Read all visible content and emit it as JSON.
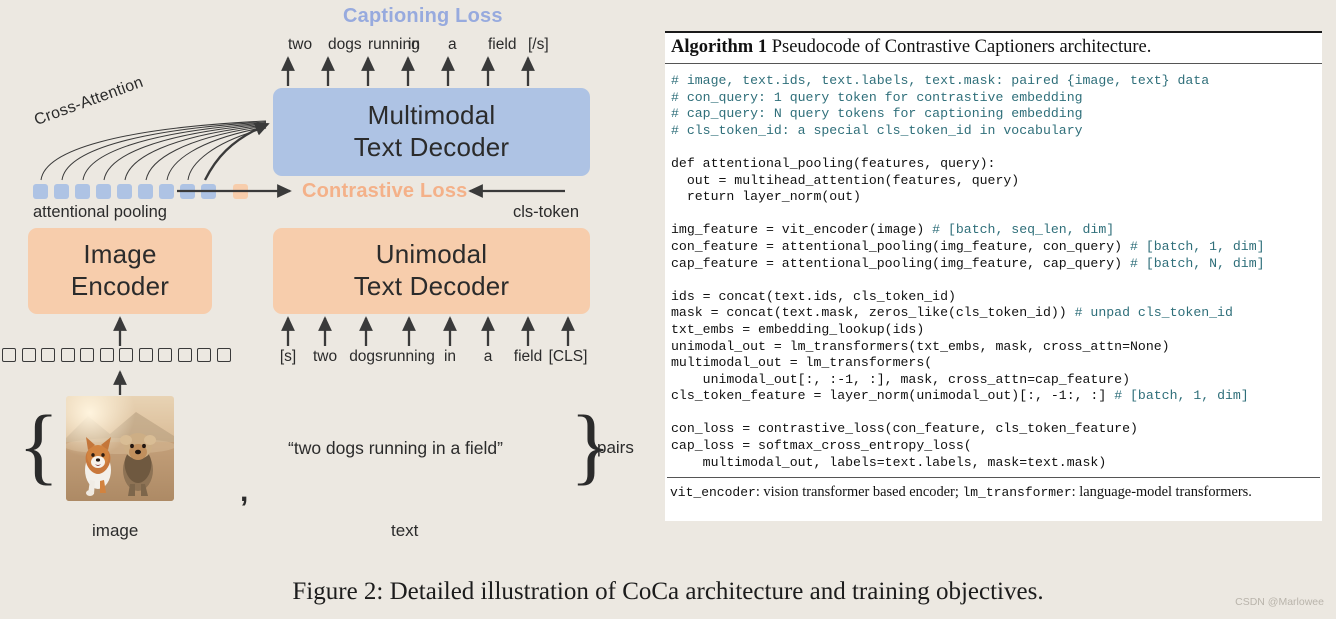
{
  "background_color": "#ece8e1",
  "colors": {
    "box_blue": "#aec3e4",
    "box_orange": "#f7cdac",
    "captioning_loss_text": "#97aade",
    "contrastive_loss_text": "#f4b189",
    "code_comment": "#2f6f7a",
    "arrow": "#3a3a3a"
  },
  "diagram": {
    "captioning_loss_label": "Captioning Loss",
    "contrastive_loss_label": "Contrastive Loss",
    "cross_attention_label": "Cross-Attention",
    "attentional_pooling_label": "attentional pooling",
    "cls_token_label": "cls-token",
    "output_words": [
      "two",
      "dogs",
      "running",
      "in",
      "a",
      "field",
      "[/s]"
    ],
    "input_words": [
      "[s]",
      "two",
      "dogs",
      "running",
      "in",
      "a",
      "field",
      "[CLS]"
    ],
    "boxes": {
      "multimodal_text_decoder": {
        "line1": "Multimodal",
        "line2": "Text Decoder"
      },
      "image_encoder": {
        "line1": "Image",
        "line2": "Encoder"
      },
      "unimodal_text_decoder": {
        "line1": "Unimodal",
        "line2": "Text Decoder"
      }
    },
    "pool_squares_blue_count": 9,
    "pool_squares_orange_count": 1,
    "patch_squares_count": 12,
    "pair": {
      "caption_quote": "“two dogs running in a field”",
      "comma": ",",
      "pairs_label": "pairs",
      "image_label": "image",
      "text_label": "text",
      "photo_alt": "two dogs running on a dirt path at sunset"
    }
  },
  "algorithm": {
    "title_bold": "Algorithm 1",
    "title_rest": "Pseudocode of Contrastive Captioners architecture.",
    "lines": [
      {
        "t": "# image, text.ids, text.labels, text.mask: paired {image, text} data",
        "c": true
      },
      {
        "t": "# con_query: 1 query token for contrastive embedding",
        "c": true
      },
      {
        "t": "# cap_query: N query tokens for captioning embedding",
        "c": true
      },
      {
        "t": "# cls_token_id: a special cls_token_id in vocabulary",
        "c": true
      },
      {
        "t": "",
        "c": false
      },
      {
        "t": "def attentional_pooling(features, query):",
        "c": false
      },
      {
        "t": "  out = multihead_attention(features, query)",
        "c": false
      },
      {
        "t": "  return layer_norm(out)",
        "c": false
      },
      {
        "t": "",
        "c": false
      },
      {
        "code": "img_feature = vit_encoder(image) ",
        "comment": "# [batch, seq_len, dim]"
      },
      {
        "code": "con_feature = attentional_pooling(img_feature, con_query) ",
        "comment": "# [batch, 1, dim]"
      },
      {
        "code": "cap_feature = attentional_pooling(img_feature, cap_query) ",
        "comment": "# [batch, N, dim]"
      },
      {
        "t": "",
        "c": false
      },
      {
        "t": "ids = concat(text.ids, cls_token_id)",
        "c": false
      },
      {
        "code": "mask = concat(text.mask, zeros_like(cls_token_id)) ",
        "comment": "# unpad cls_token_id"
      },
      {
        "t": "txt_embs = embedding_lookup(ids)",
        "c": false
      },
      {
        "t": "unimodal_out = lm_transformers(txt_embs, mask, cross_attn=None)",
        "c": false
      },
      {
        "t": "multimodal_out = lm_transformers(",
        "c": false
      },
      {
        "t": "    unimodal_out[:, :-1, :], mask, cross_attn=cap_feature)",
        "c": false
      },
      {
        "code": "cls_token_feature = layer_norm(unimodal_out)[:, -1:, :] ",
        "comment": "# [batch, 1, dim]"
      },
      {
        "t": "",
        "c": false
      },
      {
        "t": "con_loss = contrastive_loss(con_feature, cls_token_feature)",
        "c": false
      },
      {
        "t": "cap_loss = softmax_cross_entropy_loss(",
        "c": false
      },
      {
        "t": "    multimodal_out, labels=text.labels, mask=text.mask)",
        "c": false
      }
    ],
    "footnote_parts": [
      {
        "mono": true,
        "t": "vit_encoder"
      },
      {
        "mono": false,
        "t": ": vision transformer based encoder; "
      },
      {
        "mono": true,
        "t": "lm_transformer"
      },
      {
        "mono": false,
        "t": ": language-model transformers."
      }
    ]
  },
  "figure_caption": "Figure 2: Detailed illustration of CoCa architecture and training objectives.",
  "watermark": "CSDN @Marlowee"
}
